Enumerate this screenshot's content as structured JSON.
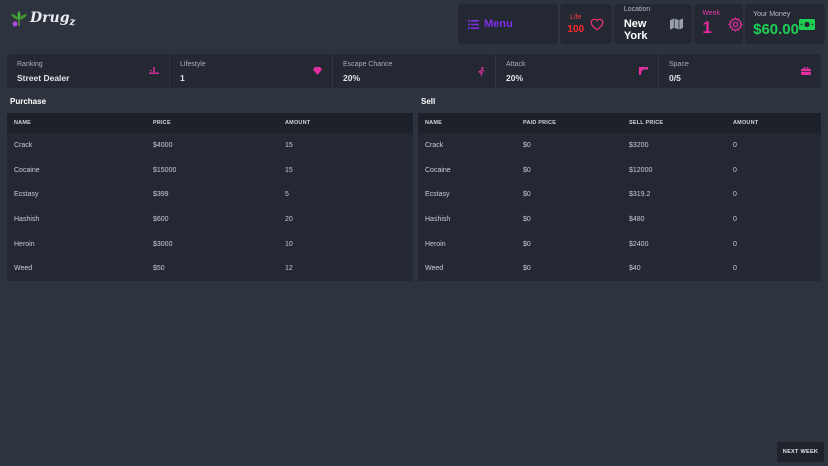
{
  "app": {
    "logo_text": "Drug",
    "logo_sub": "z"
  },
  "topbar": {
    "menu_label": "Menu",
    "life_label": "Life",
    "life_value": "100",
    "location_label": "Location",
    "location_value": "New York",
    "week_label": "Week",
    "week_value": "1",
    "money_label": "Your Money",
    "money_value": "$60.00"
  },
  "stats": [
    {
      "label": "Ranking",
      "value": "Street Dealer",
      "icon": "street-icon"
    },
    {
      "label": "Lifestyle",
      "value": "1",
      "icon": "diamond-icon"
    },
    {
      "label": "Escape Chance",
      "value": "20%",
      "icon": "running-icon"
    },
    {
      "label": "Attack",
      "value": "20%",
      "icon": "gun-icon"
    },
    {
      "label": "Space",
      "value": "0/5",
      "icon": "briefcase-icon"
    }
  ],
  "purchase": {
    "title": "Purchase",
    "columns": [
      "NAME",
      "PRICE",
      "AMOUNT"
    ],
    "rows": [
      [
        "Crack",
        "$4000",
        "15"
      ],
      [
        "Cocaine",
        "$15000",
        "15"
      ],
      [
        "Ecstasy",
        "$399",
        "5"
      ],
      [
        "Hashish",
        "$600",
        "20"
      ],
      [
        "Heroin",
        "$3000",
        "10"
      ],
      [
        "Weed",
        "$50",
        "12"
      ]
    ]
  },
  "sell": {
    "title": "Sell",
    "columns": [
      "NAME",
      "PAID PRICE",
      "SELL PRICE",
      "AMOUNT"
    ],
    "rows": [
      [
        "Crack",
        "$0",
        "$3200",
        "0"
      ],
      [
        "Cocaine",
        "$0",
        "$12000",
        "0"
      ],
      [
        "Ecstasy",
        "$0",
        "$319.2",
        "0"
      ],
      [
        "Hashish",
        "$0",
        "$480",
        "0"
      ],
      [
        "Heroin",
        "$0",
        "$2400",
        "0"
      ],
      [
        "Weed",
        "$0",
        "$40",
        "0"
      ]
    ]
  },
  "next_week_label": "NEXT WEEK",
  "colors": {
    "background": "#2d3440",
    "panel": "#232833",
    "menu_purple": "#7e2ee6",
    "life_red": "#ff2b2b",
    "week_pink": "#e52a9a",
    "money_green": "#1fcf55",
    "icon_magenta": "#e0309f"
  }
}
